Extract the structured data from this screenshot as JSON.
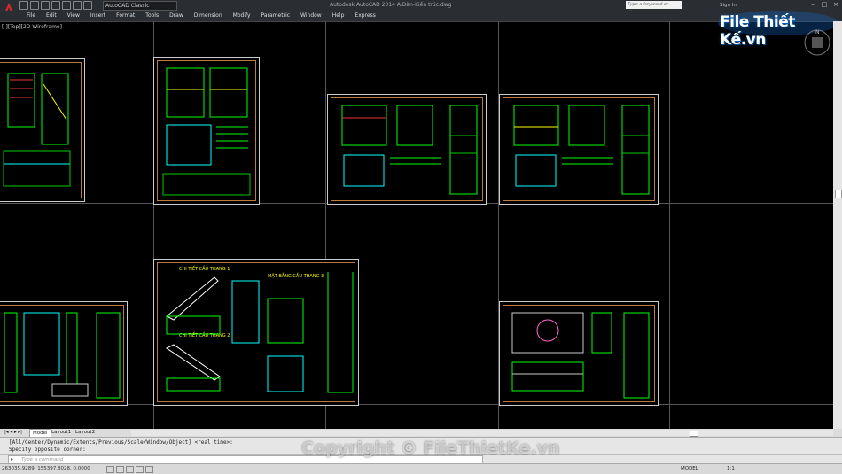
{
  "titlebar": {
    "workspace": "AutoCAD Classic",
    "title": "Autodesk AutoCAD 2014    A.Đàn-Kiến trúc.dwg",
    "search_placeholder": "Type a keyword or phrase",
    "sign_in": "Sign In"
  },
  "menu": [
    "File",
    "Edit",
    "View",
    "Insert",
    "Format",
    "Tools",
    "Draw",
    "Dimension",
    "Modify",
    "Parametric",
    "Window",
    "Help",
    "Express"
  ],
  "viewport": {
    "label": "[-][Top][2D Wireframe]"
  },
  "sheets": {
    "s3_title": "CHI TIẾT CẦU THANG 1",
    "s3_title2": "CHI TIẾT CẦU THANG 2",
    "s3_note": "MẶT BẰNG CẦU THANG 3"
  },
  "layout_tabs": [
    "Model",
    "Layout1",
    "Layout2"
  ],
  "command": {
    "history_line1": "[All/Center/Dynamic/Extents/Previous/Scale/Window/Object] <real time>:",
    "history_line2": "Specify opposite corner:",
    "placeholder": "Type a command"
  },
  "status": {
    "coordinates": "263035.9289, 155397.8028, 0.0000",
    "model": "MODEL",
    "scale": "1:1"
  },
  "watermark": "Copyright © FileThietKe.vn",
  "brand_logo": "File Thiết Kế.vn",
  "colors": {
    "background": "#000000",
    "linework": "#00ff00",
    "frame": "#bd7b3b",
    "ribbon": "#2a2e33"
  }
}
